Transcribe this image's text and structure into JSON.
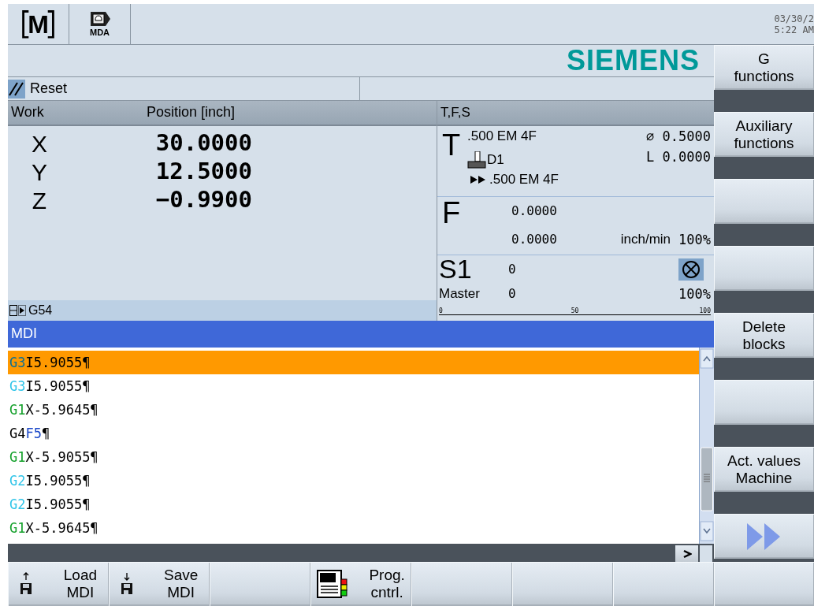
{
  "header": {
    "area_letter": "M",
    "mode": "MDA",
    "date": "03/30/2",
    "time": "5:22 AM"
  },
  "brand": "SIEMENS",
  "status": {
    "channel_state": "Reset"
  },
  "position": {
    "title": "Work",
    "column": "Position [inch]",
    "frame": "G54",
    "axes": [
      {
        "axis": "X",
        "value": "30.0000"
      },
      {
        "axis": "Y",
        "value": "12.5000"
      },
      {
        "axis": "Z",
        "value": "−0.9900"
      }
    ]
  },
  "tfs": {
    "title": "T,F,S",
    "tool": {
      "letter": "T",
      "name": ".500 EM 4F",
      "edge": "D1",
      "diameter": "⌀ 0.5000",
      "length": "L 0.0000",
      "next_tool": ".500 EM 4F"
    },
    "feed": {
      "letter": "F",
      "setpoint": "0.0000",
      "actual": "0.0000",
      "unit": "inch/min",
      "override": "100%"
    },
    "spindle": {
      "name": "S1",
      "speed": "0",
      "stopped": true,
      "role": "Master",
      "actual": "0",
      "override": "100%",
      "scale": [
        "0",
        "50",
        "100"
      ]
    }
  },
  "editor": {
    "title": "MDI",
    "lines": [
      {
        "selected": true,
        "segments": [
          {
            "kind": "arc",
            "text": "G3"
          },
          {
            "kind": "plain",
            "text": "I5.9055¶"
          }
        ]
      },
      {
        "selected": false,
        "segments": [
          {
            "kind": "arc",
            "text": "G3"
          },
          {
            "kind": "plain",
            "text": "I5.9055¶"
          }
        ]
      },
      {
        "selected": false,
        "segments": [
          {
            "kind": "linear",
            "text": "G1"
          },
          {
            "kind": "plain",
            "text": "X-5.9645¶"
          }
        ]
      },
      {
        "selected": false,
        "segments": [
          {
            "kind": "plain",
            "text": "G4"
          },
          {
            "kind": "feed",
            "text": "F5"
          },
          {
            "kind": "plain",
            "text": "¶"
          }
        ]
      },
      {
        "selected": false,
        "segments": [
          {
            "kind": "linear",
            "text": "G1"
          },
          {
            "kind": "plain",
            "text": "X-5.9055¶"
          }
        ]
      },
      {
        "selected": false,
        "segments": [
          {
            "kind": "arc",
            "text": "G2"
          },
          {
            "kind": "plain",
            "text": "I5.9055¶"
          }
        ]
      },
      {
        "selected": false,
        "segments": [
          {
            "kind": "arc",
            "text": "G2"
          },
          {
            "kind": "plain",
            "text": "I5.9055¶"
          }
        ]
      },
      {
        "selected": false,
        "segments": [
          {
            "kind": "linear",
            "text": "G1"
          },
          {
            "kind": "plain",
            "text": "X-5.9645¶"
          }
        ]
      }
    ]
  },
  "vertical_softkeys": [
    {
      "kind": "text",
      "lines": [
        "G",
        "functions"
      ]
    },
    {
      "kind": "text",
      "lines": [
        "Auxiliary",
        "functions"
      ]
    },
    {
      "kind": "blank"
    },
    {
      "kind": "blank"
    },
    {
      "kind": "text",
      "lines": [
        "Delete",
        "blocks"
      ]
    },
    {
      "kind": "blank"
    },
    {
      "kind": "text",
      "lines": [
        "Act. values",
        "Machine"
      ]
    },
    {
      "kind": "more"
    }
  ],
  "horizontal_softkeys": [
    {
      "kind": "load",
      "lines": [
        "Load",
        "MDI"
      ]
    },
    {
      "kind": "save",
      "lines": [
        "Save",
        "MDI"
      ]
    },
    {
      "kind": "blank"
    },
    {
      "kind": "program_control",
      "lines": [
        "Prog.",
        "cntrl."
      ]
    },
    {
      "kind": "blank"
    },
    {
      "kind": "blank"
    },
    {
      "kind": "blank"
    },
    {
      "kind": "blank"
    }
  ]
}
